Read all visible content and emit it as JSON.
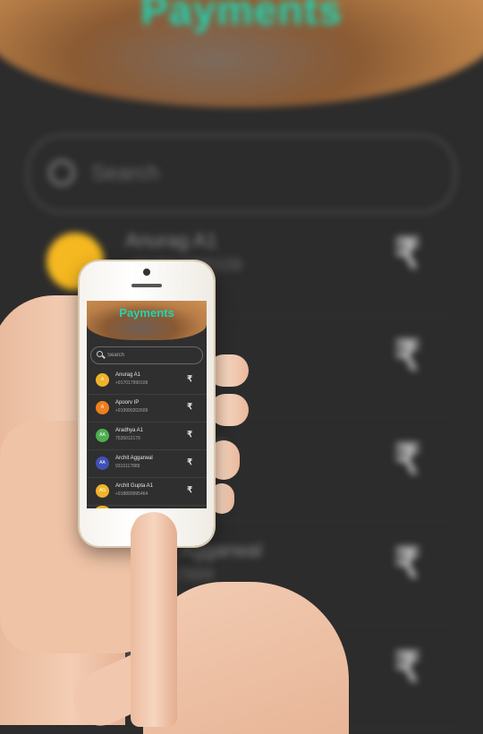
{
  "app": {
    "title": "Payments",
    "accent_color": "#1ed6b6"
  },
  "search": {
    "placeholder": "Search"
  },
  "contacts": [
    {
      "name": "Anurag A1",
      "phone": "+917017990109",
      "initials": "A",
      "avatar_color": "#f0b429"
    },
    {
      "name": "Apoorv IP",
      "phone": "+919990202609",
      "initials": "A",
      "avatar_color": "#f07f1e"
    },
    {
      "name": "Aradhya A1",
      "phone": "7535012179",
      "initials": "AA",
      "avatar_color": "#4caf50"
    },
    {
      "name": "Archit Aggarwal",
      "phone": "9310117889",
      "initials": "AA",
      "avatar_color": "#3f51b5"
    },
    {
      "name": "Archit Gupta A1",
      "phone": "+918899995464",
      "initials": "AG",
      "avatar_color": "#f0b429"
    }
  ],
  "pay_symbol": "₹",
  "background_rows": [
    {
      "name": "Anurag A1",
      "phone": "+917017990109",
      "avatar_color": "#f5b820"
    },
    {
      "name": "Apoorv IP",
      "phone": "+919990202609",
      "avatar_color": "#f07f1e"
    },
    {
      "name": "Aradhya A1",
      "phone": "7535012179",
      "avatar_color": "#4caf50"
    },
    {
      "name": "Archit Aggarwal",
      "phone": "9310117889",
      "avatar_color": "#3f51b5"
    },
    {
      "name": "Archit Gupta A1",
      "phone": "+918899995464",
      "avatar_color": "#f5b820"
    }
  ]
}
